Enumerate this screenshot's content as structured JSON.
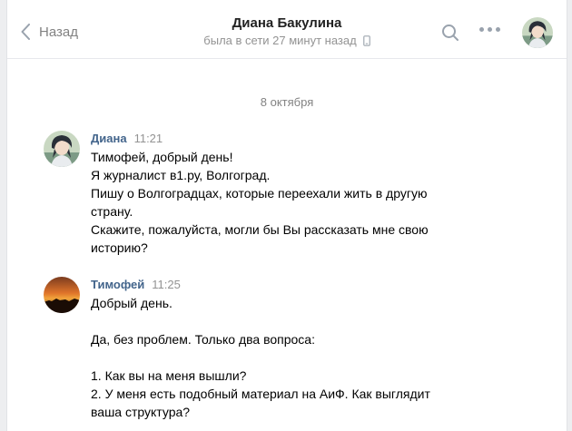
{
  "header": {
    "back_label": "Назад",
    "peer_name": "Диана Бакулина",
    "peer_status": "была в сети 27 минут назад"
  },
  "date_separator": "8 октября",
  "messages": [
    {
      "author": "Диана",
      "time": "11:21",
      "lines": [
        "Тимофей, добрый день!",
        "Я журналист в1.ру, Волгоград.",
        "Пишу о Волгоградцах, которые переехали жить в другую",
        "страну.",
        "Скажите, пожалуйста, могли бы Вы рассказать мне свою",
        "историю?"
      ]
    },
    {
      "author": "Тимофей",
      "time": "11:25",
      "lines": [
        "Добрый день.",
        "",
        "Да, без проблем. Только два вопроса:",
        "",
        "1. Как вы на меня вышли?",
        "2. У меня есть подобный материал на АиФ. Как выглядит",
        "ваша структура?"
      ]
    }
  ],
  "icons": {
    "back": "chevron-left-icon",
    "status_device": "phone-icon",
    "search": "search-icon",
    "more": "more-icon"
  },
  "colors": {
    "link": "#42648b",
    "muted": "#939393"
  }
}
